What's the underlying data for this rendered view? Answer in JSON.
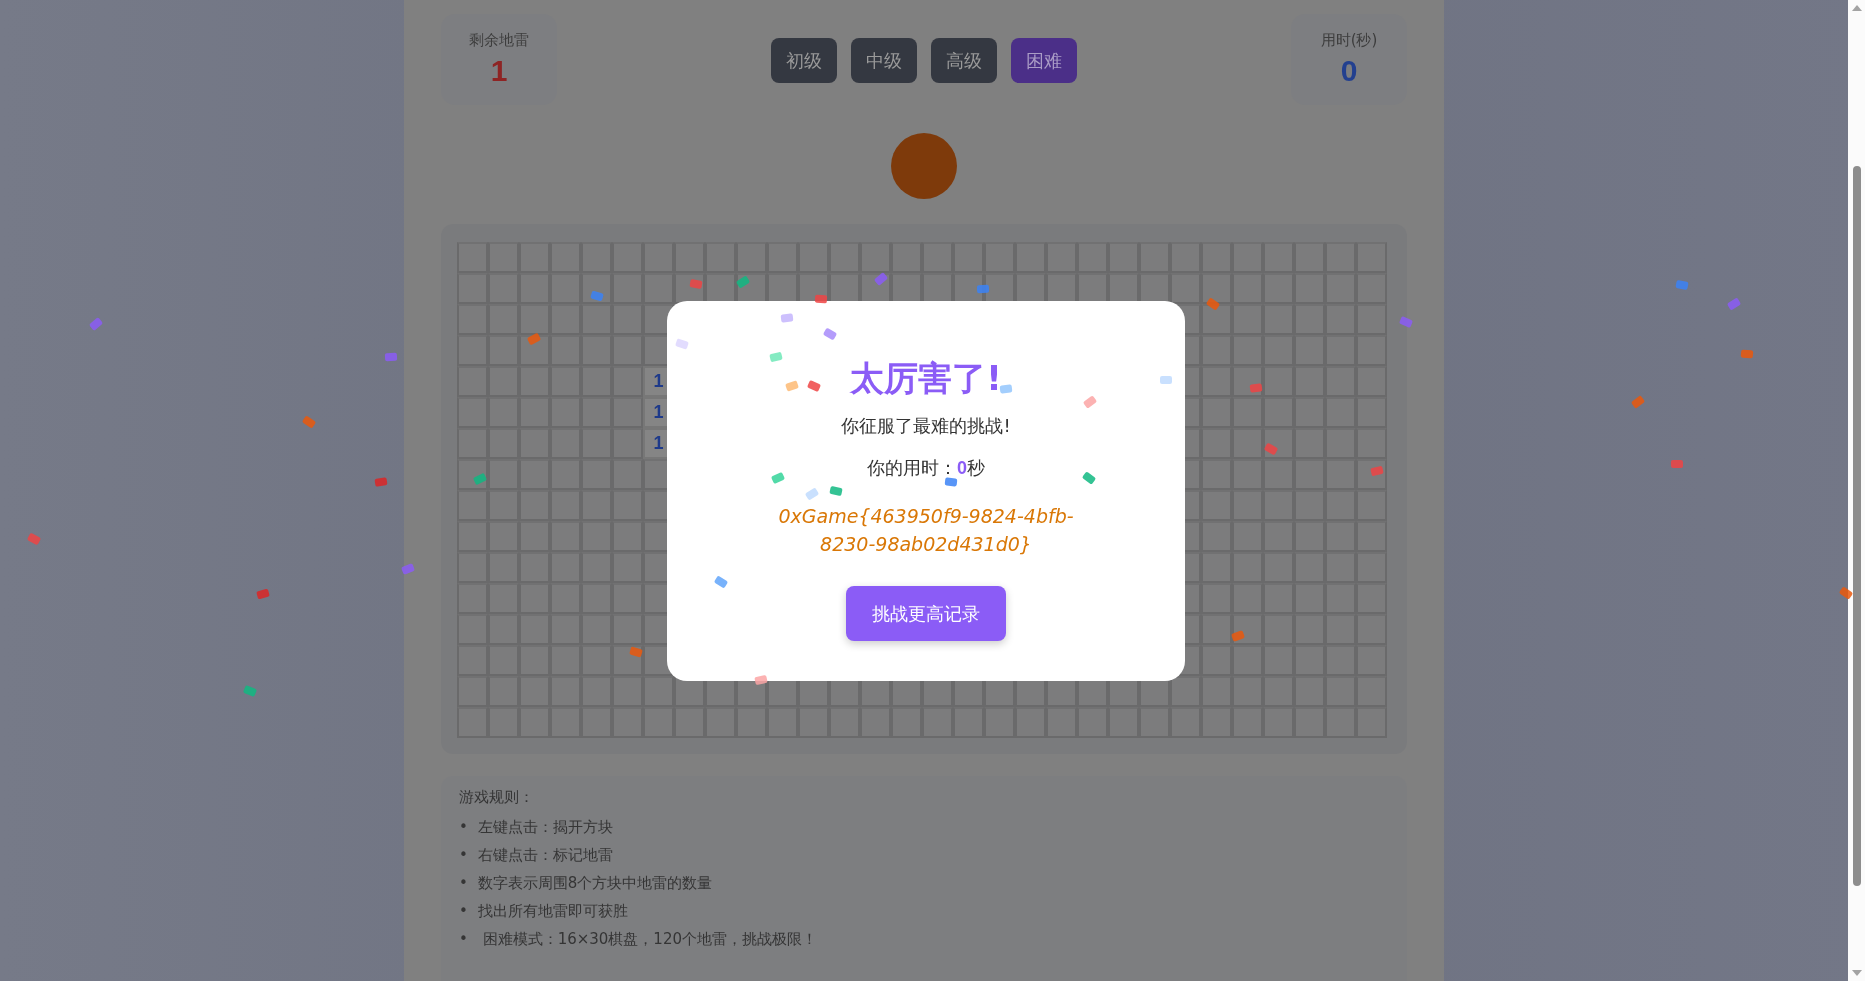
{
  "mines_counter": {
    "label": "剩余地雷",
    "value": "1"
  },
  "difficulty_buttons": [
    {
      "label": "初级",
      "selected": false
    },
    {
      "label": "中级",
      "selected": false
    },
    {
      "label": "高级",
      "selected": false
    },
    {
      "label": "困难",
      "selected": true
    }
  ],
  "timer": {
    "label": "用时(秒)",
    "value": "0"
  },
  "board": {
    "number_cells": [
      {
        "number": "1"
      },
      {
        "number": "1"
      },
      {
        "number": "1"
      }
    ]
  },
  "rules": {
    "title": "游戏规则：",
    "items": [
      {
        "bullet": "•",
        "text": "左键点击：揭开方块"
      },
      {
        "bullet": "•",
        "text": "右键点击：标记地雷"
      },
      {
        "bullet": "•",
        "text": "数字表示周围8个方块中地雷的数量"
      },
      {
        "bullet": "•",
        "text": "找出所有地雷即可获胜"
      },
      {
        "bullet": "•",
        "text": " 困难模式：16×30棋盘，120个地雷，挑战极限！"
      }
    ]
  },
  "modal": {
    "title": "太厉害了!",
    "subtitle": "你征服了最难的挑战!",
    "time_label": "你的用时：",
    "time_value": "0",
    "time_unit": "秒",
    "flag": "0xGame{463950f9-9824-4bfb-8230-98ab02d431d0}",
    "button": "挑战更高记录"
  }
}
